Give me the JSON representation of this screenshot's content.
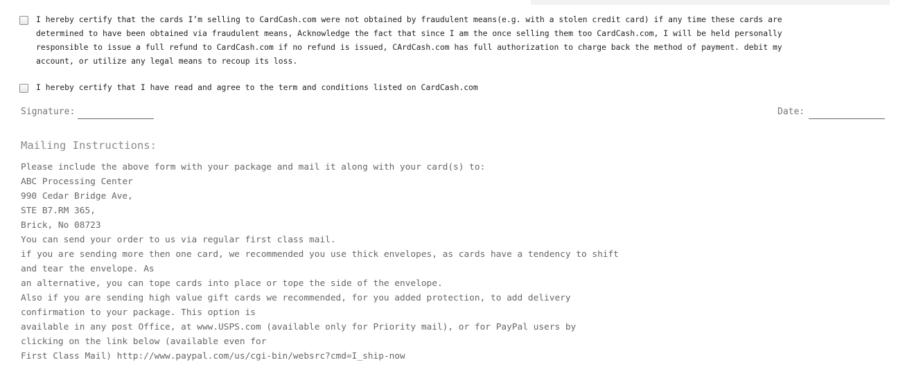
{
  "certifications": [
    {
      "text": "I hereby certify that the cards I’m selling to CardCash.com were not obtained by fraudulent means(e.g. with a stolen credit card) if any time these cards are determined to have been obtained via fraudulent means, Acknowledge the fact that since I am the once selling them too CardCash.com, I will be held personally responsible to issue a full refund to CardCash.com if no refund is issued, CArdCash.com has full authorization to charge back the method of payment. debit my account, or utilize any legal means to recoup its loss."
    },
    {
      "text": "I hereby certify that I have read and agree to the term and conditions listed on CardCash.com"
    }
  ],
  "signature": {
    "label": "Signature:"
  },
  "date": {
    "label": "Date:"
  },
  "mailing": {
    "heading": "Mailing Instructions:",
    "lines": [
      "Please include the above form with your package and mail it along with your card(s) to:",
      "ABC Processing Center",
      "990 Cedar Bridge Ave,",
      "STE B7.RM 365,",
      "Brick, No 08723",
      "You can send your order to us via regular first class mail.",
      "if you are sending more then one card, we recommended you use thick envelopes, as cards have a tendency to shift",
      "and tear the envelope. As",
      "an alternative, you can tope cards into place or tope the side of the envelope.",
      "Also if you are sending high value gift cards we recommended, for you added protection, to add delivery",
      "confirmation to your package. This option is",
      "available in any post Office, at www.USPS.com (available only for Priority mail), or for PayPal users by",
      "clicking on the link below (available even for",
      "First Class Mail) http://www.paypal.com/us/cgi-bin/websrc?cmd=I_ship-now"
    ]
  }
}
